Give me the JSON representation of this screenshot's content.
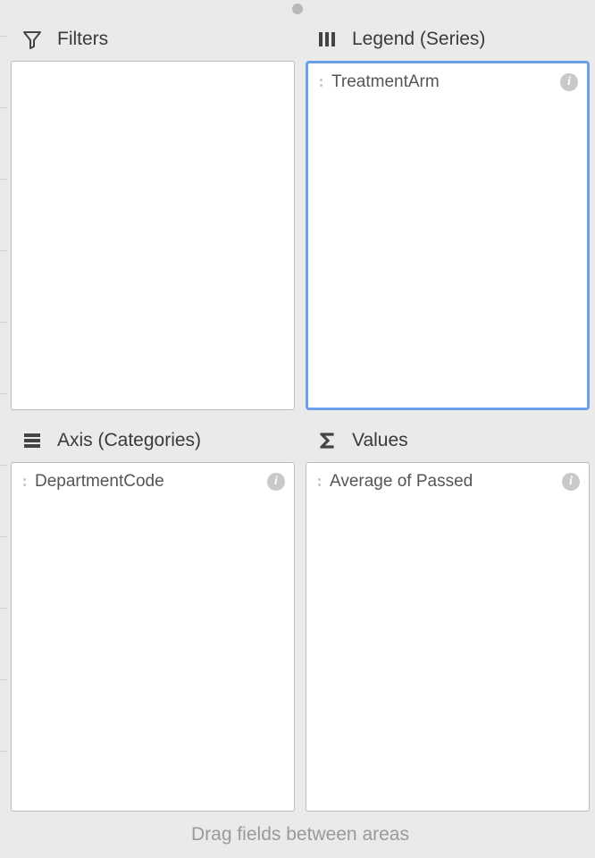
{
  "areas": {
    "filters": {
      "title": "Filters",
      "items": []
    },
    "legend": {
      "title": "Legend (Series)",
      "selected": true,
      "items": [
        {
          "label": "TreatmentArm"
        }
      ]
    },
    "axis": {
      "title": "Axis (Categories)",
      "items": [
        {
          "label": "DepartmentCode"
        }
      ]
    },
    "values": {
      "title": "Values",
      "items": [
        {
          "label": "Average of Passed"
        }
      ]
    }
  },
  "hint": "Drag fields between areas",
  "glyphs": {
    "info": "i"
  }
}
